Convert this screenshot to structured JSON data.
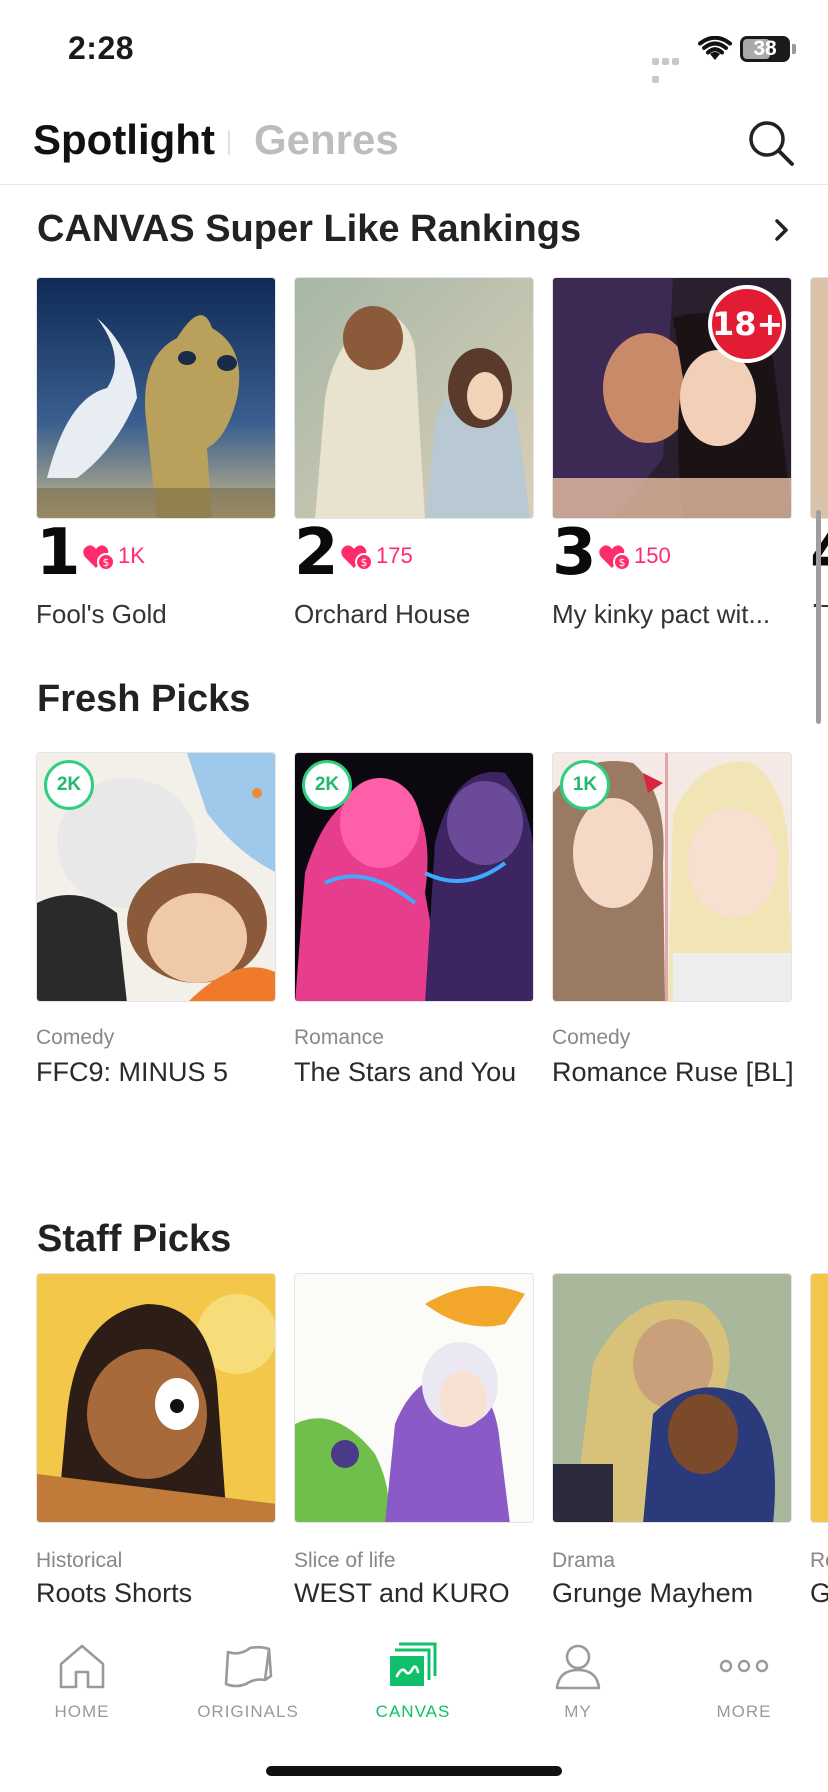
{
  "status_bar": {
    "time": "2:28",
    "battery": "38"
  },
  "header": {
    "tab_active": "Spotlight",
    "tab_inactive": "Genres"
  },
  "rankings": {
    "title": "CANVAS Super Like Rankings",
    "items": [
      {
        "rank": "1",
        "likes": "1K",
        "title": "Fool's Gold"
      },
      {
        "rank": "2",
        "likes": "175",
        "title": "Orchard House"
      },
      {
        "rank": "3",
        "likes": "150",
        "title": "My kinky pact wit...",
        "age_badge": "18+"
      },
      {
        "rank": "4",
        "likes": "",
        "title": "[F"
      }
    ]
  },
  "fresh_picks": {
    "title": "Fresh Picks",
    "items": [
      {
        "badge": "2K",
        "genre": "Comedy",
        "title": "FFC9: MINUS 5"
      },
      {
        "badge": "2K",
        "genre": "Romance",
        "title": "The Stars and You"
      },
      {
        "badge": "1K",
        "genre": "Comedy",
        "title": "Romance Ruse [BL]"
      }
    ]
  },
  "staff_picks": {
    "title": "Staff Picks",
    "items": [
      {
        "genre": "Historical",
        "title": "Roots Shorts"
      },
      {
        "genre": "Slice of life",
        "title": "WEST and KURO"
      },
      {
        "genre": "Drama",
        "title": "Grunge Mayhem"
      },
      {
        "genre": "Ro",
        "title": "G"
      }
    ]
  },
  "nav": {
    "items": [
      {
        "label": "HOME",
        "icon": "home-icon"
      },
      {
        "label": "ORIGINALS",
        "icon": "originals-icon"
      },
      {
        "label": "CANVAS",
        "icon": "canvas-icon",
        "active": true
      },
      {
        "label": "MY",
        "icon": "person-icon"
      },
      {
        "label": "MORE",
        "icon": "more-icon"
      }
    ]
  },
  "colors": {
    "accent_green": "#0fbf6a",
    "like_pink": "#ff2b6b",
    "age_red": "#e21c32"
  }
}
